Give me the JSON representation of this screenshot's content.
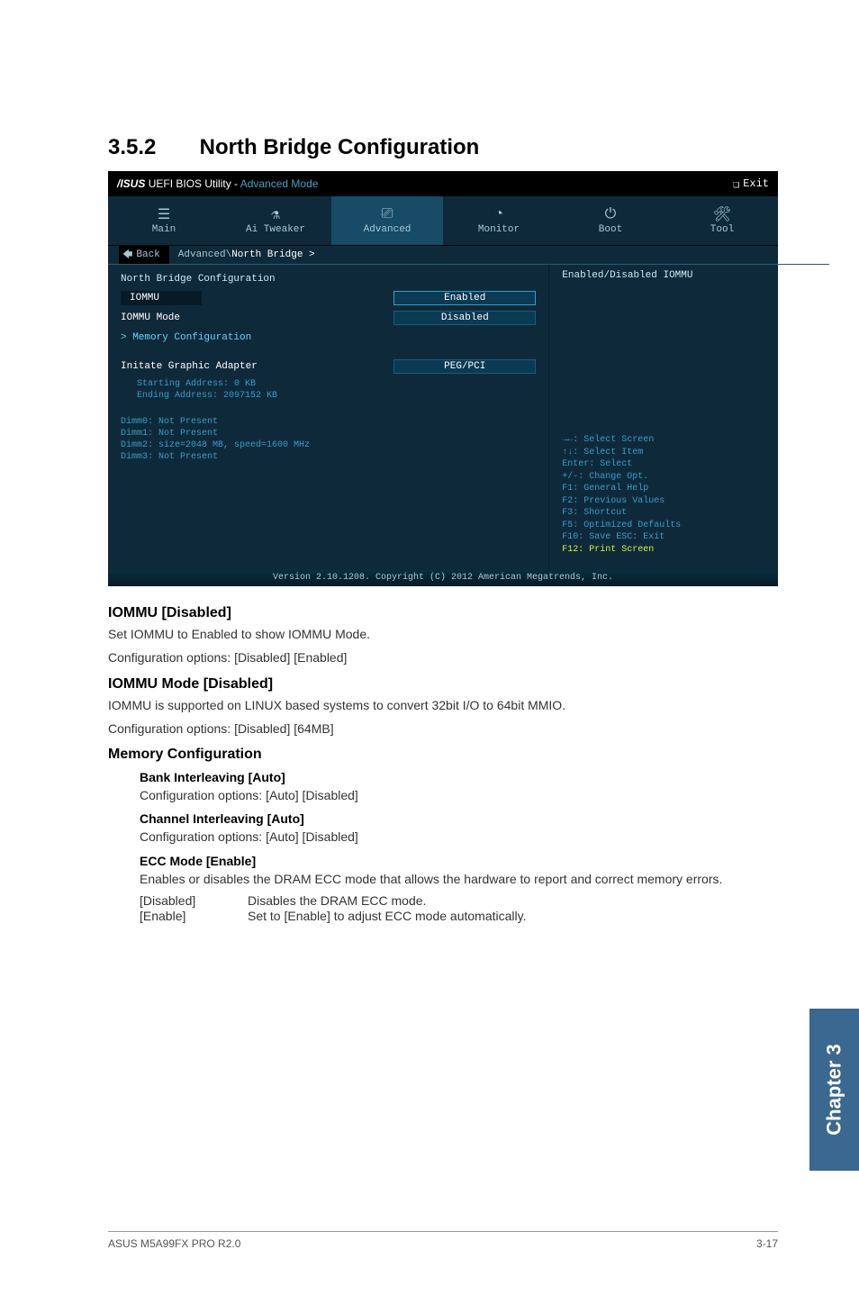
{
  "section": {
    "number": "3.5.2",
    "title": "North Bridge Configuration"
  },
  "bios": {
    "brand": "/ISUS",
    "title": "UEFI BIOS Utility - ",
    "title_mode": "Advanced Mode",
    "exit": "Exit",
    "tabs": {
      "main": "Main",
      "tweaker": "Ai Tweaker",
      "advanced": "Advanced",
      "monitor": "Monitor",
      "boot": "Boot",
      "tool": "Tool"
    },
    "breadcrumb": {
      "back": "Back",
      "root": "Advanced\\",
      "current": "North Bridge >"
    },
    "body": {
      "header": "North Bridge Configuration",
      "iommu": {
        "label": "IOMMU",
        "value": "Enabled"
      },
      "iommu_mode": {
        "label": "IOMMU Mode",
        "value": "Disabled"
      },
      "mem_config": "Memory Configuration",
      "initate": {
        "label": "Initate Graphic Adapter",
        "value": "PEG/PCI"
      },
      "start_addr": "Starting Address: 0 KB",
      "end_addr": "Ending Address: 2097152 KB",
      "dimm0": "Dimm0: Not Present",
      "dimm1": "Dimm1: Not Present",
      "dimm2": "Dimm2: size=2048 MB, speed=1600 MHz",
      "dimm3": "Dimm3: Not Present"
    },
    "right": {
      "help_title": "Enabled/Disabled IOMMU",
      "keys": {
        "k1": "→←: Select Screen",
        "k2": "↑↓: Select Item",
        "k3": "Enter: Select",
        "k4": "+/-: Change Opt.",
        "k5": "F1: General Help",
        "k6": "F2: Previous Values",
        "k7": "F3: Shortcut",
        "k8": "F5: Optimized Defaults",
        "k9": "F10: Save  ESC: Exit",
        "k10": "F12: Print Screen"
      }
    },
    "footer": "Version 2.10.1208. Copyright (C) 2012 American Megatrends, Inc."
  },
  "doc": {
    "iommu_h": "IOMMU [Disabled]",
    "iommu_p1": "Set IOMMU to Enabled to show IOMMU Mode.",
    "iommu_p2": "Configuration options: [Disabled] [Enabled]",
    "iommu_mode_h": "IOMMU Mode [Disabled]",
    "iommu_mode_p1": "IOMMU is supported on LINUX based systems to convert 32bit I/O to 64bit MMIO.",
    "iommu_mode_p2": "Configuration options: [Disabled] [64MB]",
    "mem_h": "Memory Configuration",
    "bank_h": "Bank Interleaving [Auto]",
    "bank_p": "Configuration options: [Auto] [Disabled]",
    "chan_h": "Channel Interleaving [Auto]",
    "chan_p": "Configuration options: [Auto] [Disabled]",
    "ecc_h": "ECC Mode [Enable]",
    "ecc_p": "Enables or disables the DRAM ECC mode that allows the hardware to report and correct memory errors.",
    "ecc_disabled_k": "[Disabled]",
    "ecc_disabled_v": "Disables the DRAM ECC mode.",
    "ecc_enable_k": "[Enable]",
    "ecc_enable_v": "Set to [Enable] to adjust ECC mode automatically."
  },
  "chapter_tab": "Chapter 3",
  "footer": {
    "left": "ASUS M5A99FX PRO R2.0",
    "right": "3-17"
  }
}
